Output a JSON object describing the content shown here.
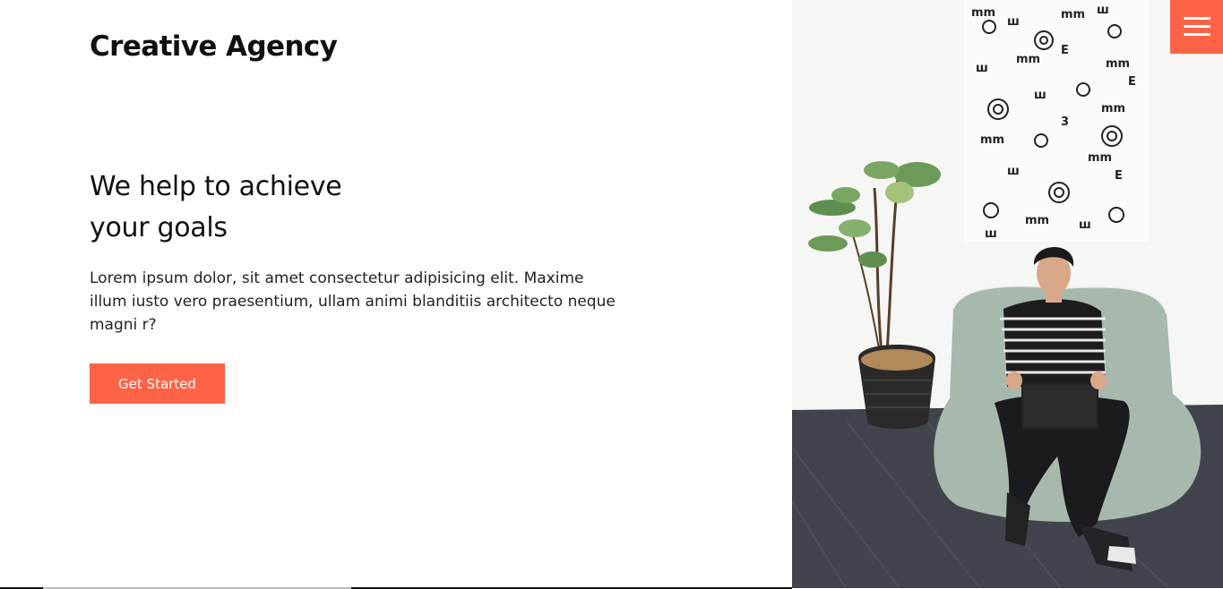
{
  "brand": {
    "name": "Creative Agency"
  },
  "hero": {
    "headline_line1": "We help to achieve",
    "headline_line2": "your goals",
    "description": "Lorem ipsum dolor, sit amet consectetur adipisicing elit. Maxime illum iusto vero praesentium, ullam animi blanditiis architecto neque magni r?",
    "cta_label": "Get Started"
  },
  "menu": {
    "icon": "hamburger-menu-icon"
  },
  "colors": {
    "accent": "#ff6347",
    "text": "#111111",
    "background": "#ffffff"
  }
}
